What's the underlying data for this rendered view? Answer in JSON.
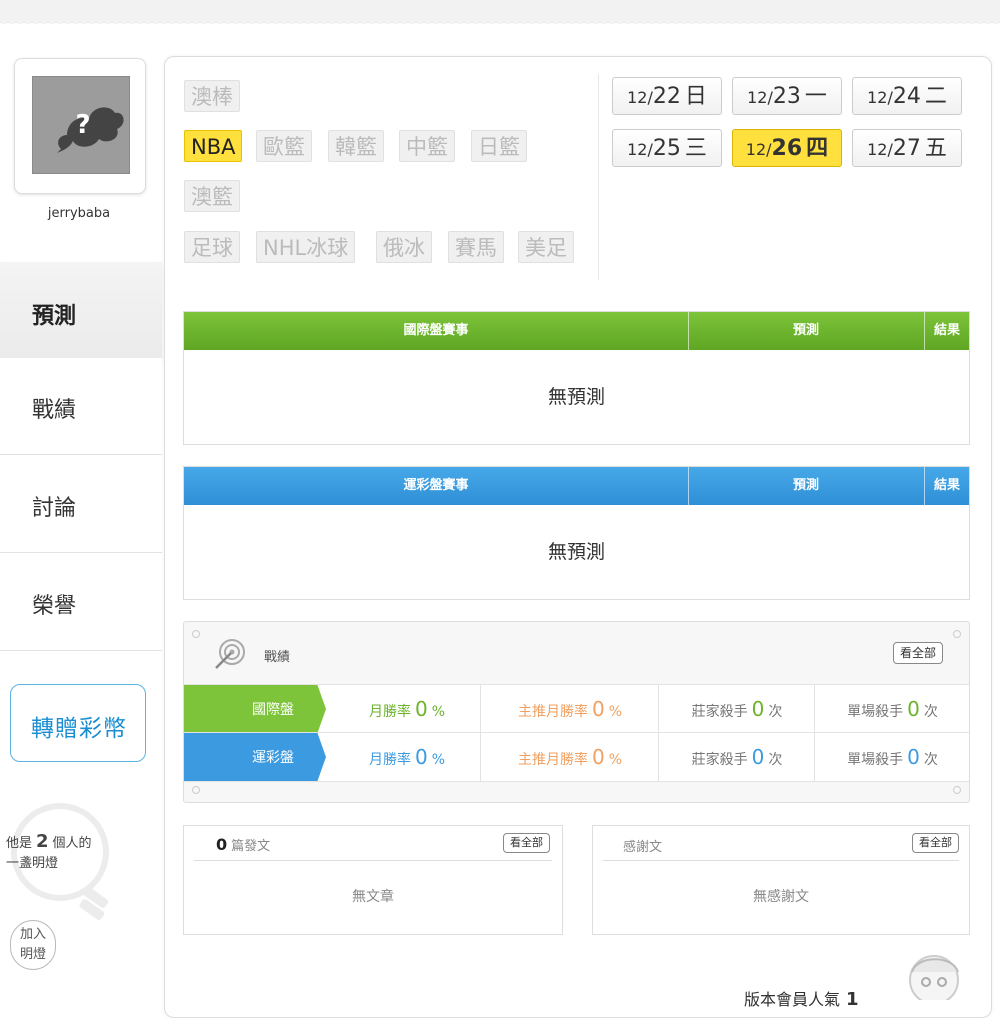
{
  "profile": {
    "username": "jerrybaba"
  },
  "left_nav": [
    {
      "label": "預測",
      "active": true
    },
    {
      "label": "戰績",
      "active": false
    },
    {
      "label": "討論",
      "active": false
    },
    {
      "label": "榮譽",
      "active": false
    }
  ],
  "gift_button": "轉贈彩幣",
  "light": {
    "prefix": "他是",
    "count": "2",
    "suffix": "個人的",
    "line2": "一盞明燈",
    "join_line1": "加入",
    "join_line2": "明燈"
  },
  "leagues": {
    "row1": [
      "澳棒"
    ],
    "row2": [
      "NBA",
      "歐籃",
      "韓籃",
      "中籃",
      "日籃"
    ],
    "row3": [
      "澳籃"
    ],
    "row4": [
      "足球",
      "NHL冰球",
      "俄冰",
      "賽馬",
      "美足"
    ],
    "active": "NBA"
  },
  "dates": [
    {
      "month": "12/",
      "day": "22",
      "weekday": "日",
      "active": false
    },
    {
      "month": "12/",
      "day": "23",
      "weekday": "一",
      "active": false
    },
    {
      "month": "12/",
      "day": "24",
      "weekday": "二",
      "active": false
    },
    {
      "month": "12/",
      "day": "25",
      "weekday": "三",
      "active": false
    },
    {
      "month": "12/",
      "day": "26",
      "weekday": "四",
      "active": true
    },
    {
      "month": "12/",
      "day": "27",
      "weekday": "五",
      "active": false
    }
  ],
  "intl_table": {
    "col_event": "國際盤賽事",
    "col_predict": "預測",
    "col_result": "結果",
    "empty": "無預測",
    "color": "#6bb52c"
  },
  "sports_table": {
    "col_event": "運彩盤賽事",
    "col_predict": "預測",
    "col_result": "結果",
    "empty": "無預測",
    "color": "#3c9be0"
  },
  "record": {
    "title": "戰績",
    "see_all": "看全部",
    "rows": [
      {
        "label": "國際盤",
        "monthly_label": "月勝率",
        "monthly_value": "0",
        "monthly_unit": "%",
        "home_label": "主推月勝率",
        "home_value": "0",
        "home_unit": "%",
        "banker_label": "莊家殺手",
        "banker_value": "0",
        "banker_unit": "次",
        "single_label": "單場殺手",
        "single_value": "0",
        "single_unit": "次"
      },
      {
        "label": "運彩盤",
        "monthly_label": "月勝率",
        "monthly_value": "0",
        "monthly_unit": "%",
        "home_label": "主推月勝率",
        "home_value": "0",
        "home_unit": "%",
        "banker_label": "莊家殺手",
        "banker_value": "0",
        "banker_unit": "次",
        "single_label": "單場殺手",
        "single_value": "0",
        "single_unit": "次"
      }
    ]
  },
  "posts": {
    "count": "0",
    "label": "篇發文",
    "see_all": "看全部",
    "empty": "無文章"
  },
  "thanks": {
    "label": "感謝文",
    "see_all": "看全部",
    "empty": "無感謝文"
  },
  "footer": {
    "text": "版本會員人氣",
    "value": "1"
  },
  "icons": [
    "avatar-placeholder-icon",
    "bulb-icon",
    "target-icon",
    "mascot-icon"
  ]
}
